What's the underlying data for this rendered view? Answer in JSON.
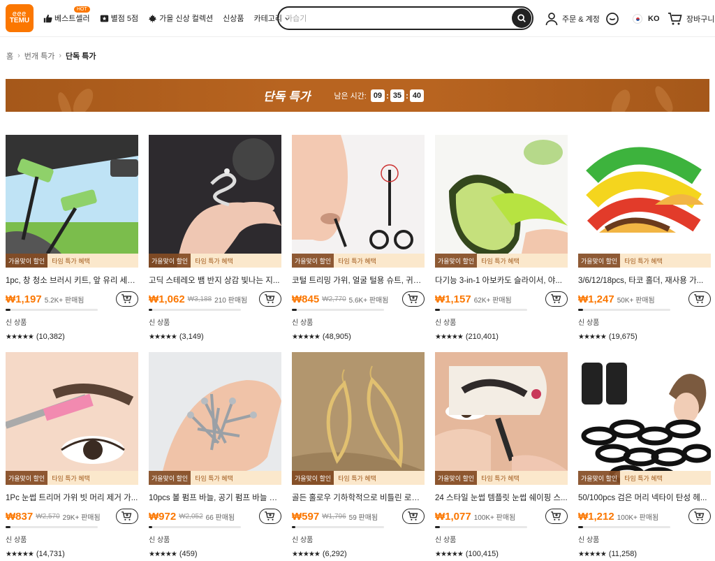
{
  "header": {
    "logo_top": "ᘓᘓᘓ",
    "logo_text": "TEMU",
    "nav": [
      {
        "label": "베스트셀러",
        "icon": "thumbs-up-icon",
        "badge": "HOT"
      },
      {
        "label": "별점 5점",
        "icon": "star-box-icon"
      },
      {
        "label": "가을 신상 컬렉션",
        "icon": "maple-leaf-icon"
      },
      {
        "label": "신상품"
      },
      {
        "label": "카테고리",
        "icon": "chevron-down-icon"
      }
    ],
    "search_placeholder": "가습기",
    "account_label": "주문 & 계정",
    "lang_label": "KO",
    "cart_label": "장바구니"
  },
  "breadcrumb": [
    "홈",
    "번개 특가",
    "단독 특가"
  ],
  "banner": {
    "title": "단독 특가",
    "timer_label": "남은 시간:",
    "hours": "09",
    "minutes": "35",
    "seconds": "40"
  },
  "tags": {
    "tag1": "가을맞이 할인",
    "tag2": "타임 특가 혜택"
  },
  "colors": {
    "accent": "#fb7701",
    "banner": "#b86420"
  },
  "products": [
    {
      "title": "1pc, 창 청소 브러시 키트, 앞 유리 세척...",
      "price": "₩1,197",
      "old_price": "",
      "sold": "5.2K+ 판매됨",
      "progress": 0.05,
      "new_label": "신 상품",
      "stars": "★★★★★",
      "reviews": "(10,382)",
      "img": "car-window"
    },
    {
      "title": "고딕 스테레오 뱀 반지 상감 빛나는 지...",
      "price": "₩1,062",
      "old_price": "₩3,188",
      "sold": "210 판매됨",
      "progress": 0.04,
      "new_label": "신 상품",
      "stars": "★★★★★",
      "reviews": "(3,149)",
      "img": "snake-ring"
    },
    {
      "title": "코털 트리밍 가위, 얼굴 털용 슈트, 귀털...",
      "price": "₩845",
      "old_price": "₩2,770",
      "sold": "5.6K+ 판매됨",
      "progress": 0.05,
      "new_label": "신 상품",
      "stars": "★★★★★",
      "reviews": "(48,905)",
      "img": "nose-scissors"
    },
    {
      "title": "다기능 3-in-1 아보카도 슬라이서, 야...",
      "price": "₩1,157",
      "old_price": "",
      "sold": "62K+ 판매됨",
      "progress": 0.05,
      "new_label": "신 상품",
      "stars": "★★★★★",
      "reviews": "(210,401)",
      "img": "avocado"
    },
    {
      "title": "3/6/12/18pcs, 타코 홀더, 재사용 가...",
      "price": "₩1,247",
      "old_price": "",
      "sold": "50K+ 판매됨",
      "progress": 0.05,
      "new_label": "신 상품",
      "stars": "★★★★★",
      "reviews": "(19,675)",
      "img": "taco"
    },
    {
      "title": "1Pc 눈썹 트리머 가위 빗 머리 제거 가...",
      "price": "₩837",
      "old_price": "₩2,570",
      "sold": "29K+ 판매됨",
      "progress": 0.05,
      "new_label": "신 상품",
      "stars": "★★★★★",
      "reviews": "(14,731)",
      "img": "brow-comb"
    },
    {
      "title": "10pcs 볼 펌프 바늘, 공기 펌프 바늘 팽...",
      "price": "₩972",
      "old_price": "₩2,052",
      "sold": "66 판매됨",
      "progress": 0.04,
      "new_label": "신 상품",
      "stars": "★★★★★",
      "reviews": "(459)",
      "img": "needles"
    },
    {
      "title": "골든 홀로우 기하학적으로 비틀린 로즈 ...",
      "price": "₩597",
      "old_price": "₩1,796",
      "sold": "59 판매됨",
      "progress": 0.04,
      "new_label": "신 상품",
      "stars": "★★★★★",
      "reviews": "(6,292)",
      "img": "earrings"
    },
    {
      "title": "24 스타일 눈썹 템플릿 눈썹 쉐이핑 스...",
      "price": "₩1,077",
      "old_price": "",
      "sold": "100K+ 판매됨",
      "progress": 0.05,
      "new_label": "신 상품",
      "stars": "★★★★★",
      "reviews": "(100,415)",
      "img": "brow-template"
    },
    {
      "title": "50/100pcs 검은 머리 넥타이 탄성 헤...",
      "price": "₩1,212",
      "old_price": "",
      "sold": "100K+ 판매됨",
      "progress": 0.05,
      "new_label": "신 상품",
      "stars": "★★★★★",
      "reviews": "(11,258)",
      "img": "hair-ties"
    }
  ]
}
